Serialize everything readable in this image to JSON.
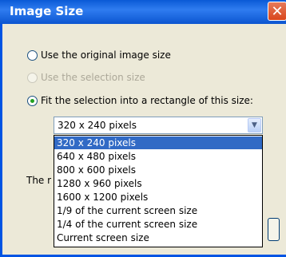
{
  "dialog": {
    "title": "Image Size",
    "close_glyph": "✕"
  },
  "options": [
    {
      "label": "Use the original image size",
      "checked": false,
      "enabled": true
    },
    {
      "label": "Use the selection size",
      "checked": false,
      "enabled": false
    },
    {
      "label": "Fit the selection into a rectangle of this size:",
      "checked": true,
      "enabled": true
    }
  ],
  "size_select": {
    "value": "320 x 240 pixels",
    "arrow_icon": "chevron-down-icon",
    "options": [
      "320 x 240 pixels",
      "640 x 480 pixels",
      "800 x 600 pixels",
      "1280 x 960 pixels",
      "1600 x 1200 pixels",
      "1/9 of the current screen size",
      "1/4 of the current screen size",
      "Current screen size"
    ],
    "highlighted_index": 0
  },
  "partial_label": "The r",
  "colors": {
    "titlebar": "#0a5ad6",
    "selection": "#316ac5",
    "radio_check": "#21a121"
  }
}
